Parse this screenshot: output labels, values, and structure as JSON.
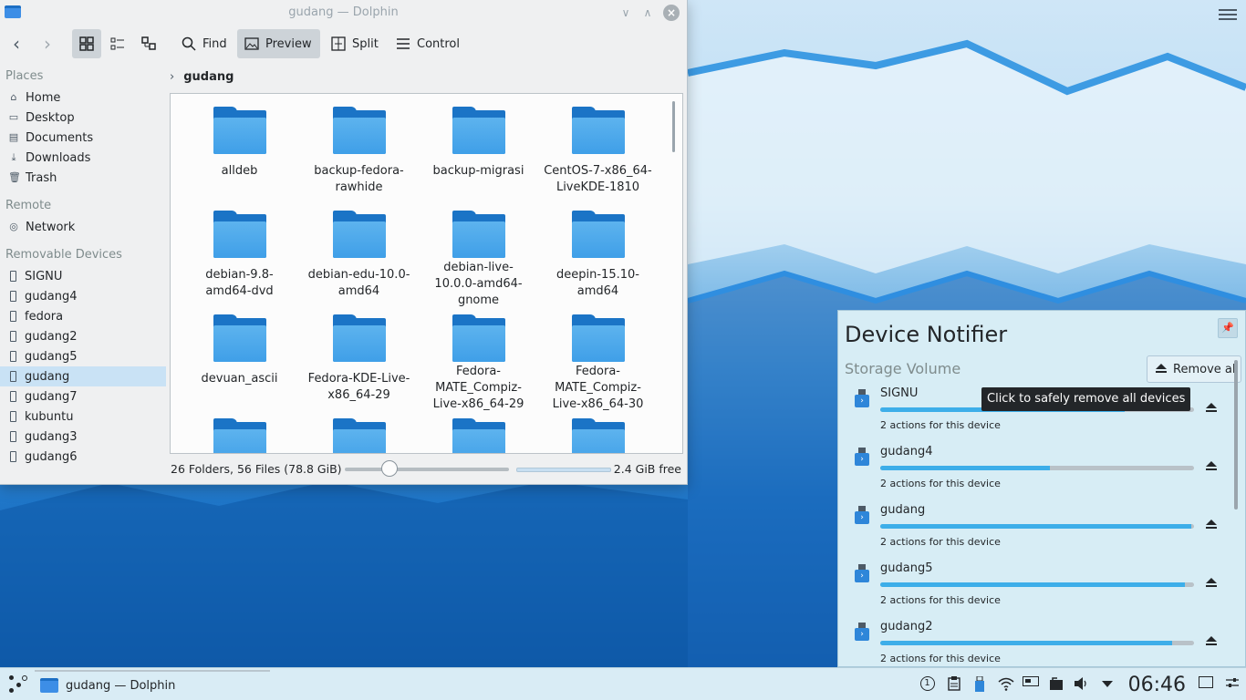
{
  "window": {
    "title": "gudang — Dolphin",
    "minimize_glyph": "∨",
    "maximize_glyph": "∧",
    "close_glyph": "×"
  },
  "toolbar": {
    "back_glyph": "‹",
    "forward_glyph": "›",
    "find_label": "Find",
    "preview_label": "Preview",
    "split_label": "Split",
    "control_label": "Control"
  },
  "sidebar": {
    "places_heading": "Places",
    "places": [
      {
        "label": "Home",
        "icon": "home-icon"
      },
      {
        "label": "Desktop",
        "icon": "desktop-icon"
      },
      {
        "label": "Documents",
        "icon": "documents-icon"
      },
      {
        "label": "Downloads",
        "icon": "downloads-icon"
      },
      {
        "label": "Trash",
        "icon": "trash-icon"
      }
    ],
    "remote_heading": "Remote",
    "remote": [
      {
        "label": "Network",
        "icon": "network-icon"
      }
    ],
    "removable_heading": "Removable Devices",
    "removable": [
      "SIGNU",
      "gudang4",
      "fedora",
      "gudang2",
      "gudang5",
      "gudang",
      "gudang7",
      "kubuntu",
      "gudang3",
      "gudang6"
    ],
    "selected": "gudang"
  },
  "breadcrumb": {
    "chevron": "›",
    "current": "gudang"
  },
  "files": [
    "alldeb",
    "backup-fedora-rawhide",
    "backup-migrasi",
    "CentOS-7-x86_64-LiveKDE-1810",
    "debian-9.8-amd64-dvd",
    "debian-edu-10.0-amd64",
    "debian-live-10.0.0-amd64-gnome",
    "deepin-15.10-amd64",
    "devuan_ascii",
    "Fedora-KDE-Live-x86_64-29",
    "Fedora-MATE_Compiz-Live-x86_64-29",
    "Fedora-MATE_Compiz-Live-x86_64-30"
  ],
  "status": {
    "summary": "26 Folders, 56 Files (78.8 GiB)",
    "free": "2.4 GiB free",
    "zoom_level_fraction": 0.27
  },
  "notifier": {
    "title": "Device Notifier",
    "section": "Storage Volume",
    "remove_all_label": "Remove all",
    "tooltip": "Click to safely remove all devices",
    "pin_glyph": "📌",
    "devices": [
      {
        "name": "SIGNU",
        "actions": "2 actions for this device",
        "usage": 0.78
      },
      {
        "name": "gudang4",
        "actions": "2 actions for this device",
        "usage": 0.54
      },
      {
        "name": "gudang",
        "actions": "2 actions for this device",
        "usage": 0.99
      },
      {
        "name": "gudang5",
        "actions": "2 actions for this device",
        "usage": 0.97
      },
      {
        "name": "gudang2",
        "actions": "2 actions for this device",
        "usage": 0.93
      }
    ]
  },
  "taskbar": {
    "task_label": "gudang — Dolphin",
    "clock": "06:46",
    "tray_icons": [
      "updates-icon",
      "clipboard-icon",
      "usb-icon",
      "wifi-icon",
      "battery-icon",
      "vault-icon",
      "volume-icon",
      "tray-expand-icon"
    ]
  },
  "colors": {
    "accent": "#3daee9",
    "folder": "#3f9fe8",
    "selection": "#c9e2f5"
  }
}
